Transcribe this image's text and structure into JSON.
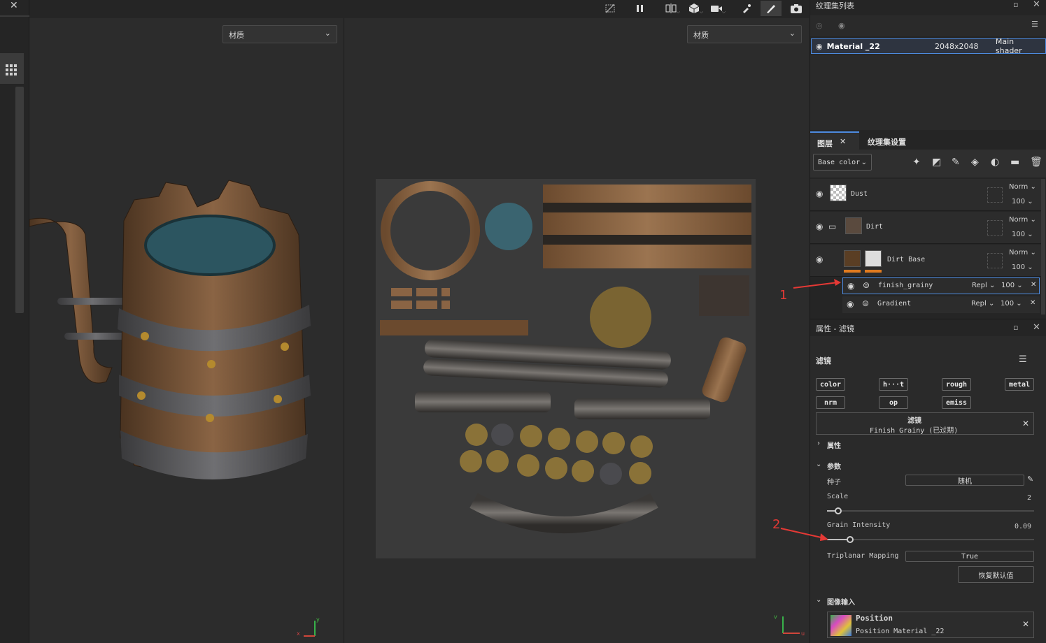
{
  "toolbar": {
    "icons": [
      "close-icon",
      "grid-icon",
      "hide-icon",
      "pause-icon",
      "split-icon",
      "cube-icon",
      "camera-video-icon",
      "brush-settings-icon",
      "paint-brush-icon",
      "screenshot-icon"
    ]
  },
  "viewport3d": {
    "material_select": "材质"
  },
  "viewport2d": {
    "material_select": "材质"
  },
  "axes": {
    "x": "x",
    "y": "y",
    "u": "u",
    "v": "v"
  },
  "texture_set_list": {
    "title": "纹理集列表",
    "row": {
      "name": "Material _22",
      "size": "2048x2048",
      "shader": "Main shader"
    }
  },
  "layers_panel": {
    "tab_layers": "图层",
    "tab_settings": "纹理集设置",
    "channel": "Base color",
    "layers": [
      {
        "name": "Dust",
        "blend": "Norm",
        "opacity": "100"
      },
      {
        "name": "Dirt",
        "blend": "Norm",
        "opacity": "100"
      },
      {
        "name": "Dirt Base",
        "blend": "Norm",
        "opacity": "100"
      }
    ],
    "effects": [
      {
        "name": "finish_grainy",
        "blend": "Repl",
        "opacity": "100"
      },
      {
        "name": "Gradient",
        "blend": "Repl",
        "opacity": "100"
      }
    ]
  },
  "properties": {
    "title": "属性 - 滤镜",
    "section": "滤镜",
    "channels": [
      "color",
      "h···t",
      "rough",
      "metal",
      "nrm",
      "op",
      "emiss"
    ],
    "filter_title": "滤镜",
    "filter_name": "Finish Grainy (已过期)",
    "group_attr": "属性",
    "group_params": "参数",
    "seed_label": "种子",
    "seed_value": "随机",
    "scale_label": "Scale",
    "scale_value": "2",
    "grain_label": "Grain Intensity",
    "grain_value": "0.09",
    "triplanar_label": "Triplanar Mapping",
    "triplanar_value": "True",
    "reset_label": "恢复默认值",
    "image_input_label": "图像输入",
    "position_title": "Position",
    "position_sub": "Position Material _22"
  },
  "annotations": {
    "a1": "1",
    "a2": "2"
  },
  "colors": {
    "accent": "#4d8be0",
    "orange": "#e07a1f",
    "annotation": "#e53935"
  }
}
